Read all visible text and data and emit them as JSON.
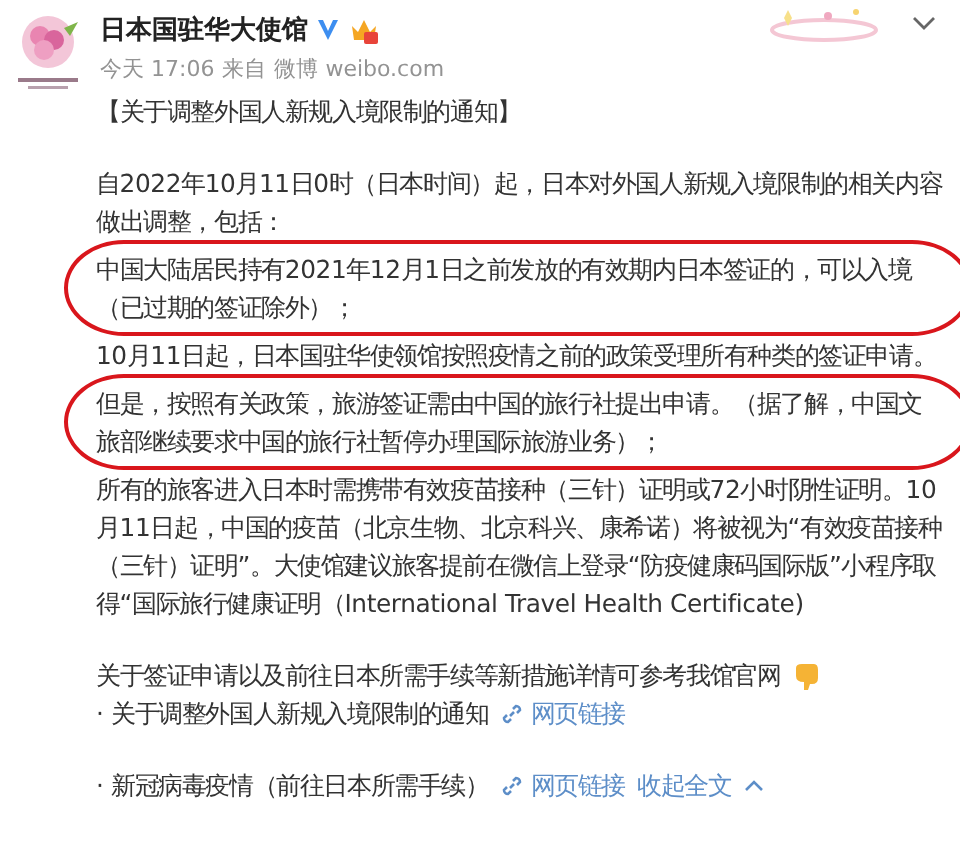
{
  "account": {
    "name": "日本国驻华大使馆",
    "verified": true
  },
  "meta": {
    "time": "今天 17:06",
    "source_prefix": "来自",
    "source": "微博 weibo.com"
  },
  "sections": [
    {
      "paragraphs": [
        {
          "kind": "text",
          "lines": [
            "【关于调整外国人新规入境限制的通知】"
          ],
          "highlighted": false
        }
      ]
    },
    {
      "paragraphs": [
        {
          "kind": "text",
          "lines": [
            "自2022年10月11日0时（日本时间）起，日本对外国人新规入境限制的相关内容",
            "做出调整，包括："
          ],
          "highlighted": false
        },
        {
          "kind": "text",
          "lines": [
            "中国大陆居民持有2021年12月1日之前发放的有效期内日本签证的，可以入境",
            "（已过期的签证除外）；"
          ],
          "highlighted": true
        },
        {
          "kind": "text",
          "lines": [
            "10月11日起，日本国驻华使领馆按照疫情之前的政策受理所有种类的签证申请。"
          ],
          "highlighted": false
        },
        {
          "kind": "text",
          "lines": [
            "但是，按照有关政策，旅游签证需由中国的旅行社提出申请。（据了解，中国文",
            "旅部继续要求中国的旅行社暂停办理国际旅游业务）；"
          ],
          "highlighted": true
        },
        {
          "kind": "text",
          "lines": [
            "所有的旅客进入日本时需携带有效疫苗接种（三针）证明或72小时阴性证明。10",
            "月11日起，中国的疫苗（北京生物、北京科兴、康希诺）将被视为“有效疫苗接种",
            "（三针）证明”。大使馆建议旅客提前在微信上登录“防疫健康码国际版”小程序取",
            "得“国际旅行健康证明（International Travel Health Certificate)"
          ],
          "highlighted": false
        }
      ]
    },
    {
      "paragraphs": [
        {
          "kind": "pointer",
          "lines": [
            "关于签证申请以及前往日本所需手续等新措施详情可参考我馆官网"
          ],
          "highlighted": false
        },
        {
          "kind": "link",
          "lines": [
            "· 关于调整外国人新规入境限制的通知"
          ],
          "link": "网页链接",
          "highlighted": false
        }
      ]
    },
    {
      "paragraphs": [
        {
          "kind": "link",
          "lines": [
            "· 新冠病毒疫情（前往日本所需手续）"
          ],
          "link": "网页链接",
          "collapse": "收起全文",
          "highlighted": false
        }
      ]
    }
  ]
}
